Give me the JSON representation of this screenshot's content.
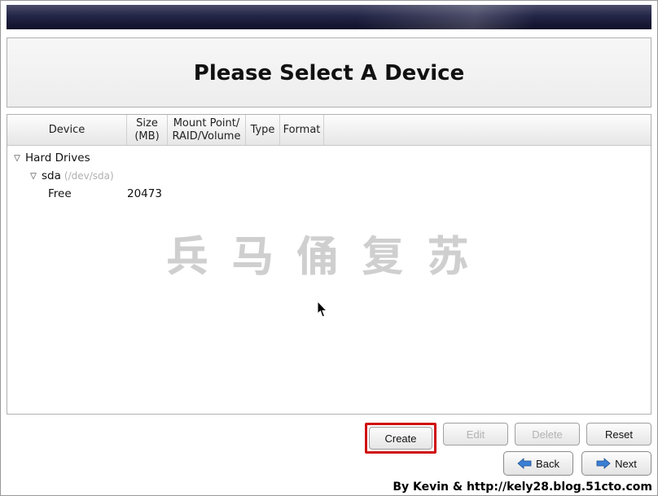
{
  "title": "Please Select A Device",
  "columns": {
    "device": "Device",
    "size_l1": "Size",
    "size_l2": "(MB)",
    "mount_l1": "Mount Point/",
    "mount_l2": "RAID/Volume",
    "type": "Type",
    "format": "Format"
  },
  "tree": {
    "hard_drives_label": "Hard Drives",
    "sda_label": "sda",
    "sda_path": "(/dev/sda)",
    "free_label": "Free",
    "free_size": "20473"
  },
  "watermark": "兵马俑复苏",
  "buttons": {
    "create": "Create",
    "edit": "Edit",
    "delete": "Delete",
    "reset": "Reset",
    "back": "Back",
    "next": "Next"
  },
  "attribution": "By Kevin & http://kely28.blog.51cto.com"
}
